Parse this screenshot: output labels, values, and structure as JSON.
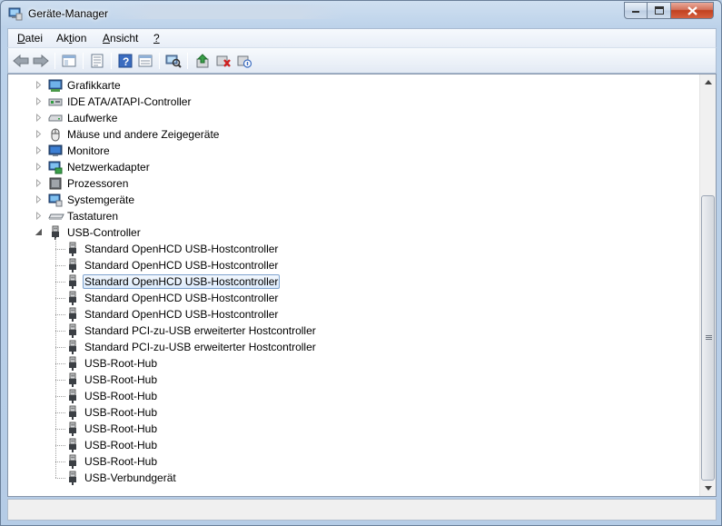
{
  "window": {
    "title": "Geräte-Manager"
  },
  "menu": [
    {
      "pre": "",
      "ul": "D",
      "post": "atei"
    },
    {
      "pre": "Ak",
      "ul": "t",
      "post": "ion"
    },
    {
      "pre": "",
      "ul": "A",
      "post": "nsicht"
    },
    {
      "pre": "",
      "ul": "?",
      "post": ""
    }
  ],
  "toolbar": [
    {
      "name": "back-button-icon"
    },
    {
      "name": "forward-button-icon"
    },
    {
      "name": "show-hide-tree-icon"
    },
    {
      "name": "properties-icon"
    },
    {
      "name": "help-icon"
    },
    {
      "name": "view-details-icon"
    },
    {
      "name": "scan-hardware-icon"
    },
    {
      "name": "update-driver-icon"
    },
    {
      "name": "uninstall-icon"
    },
    {
      "name": "disable-device-icon"
    }
  ],
  "tree": {
    "categories": [
      {
        "label": "Grafikkarte",
        "icon": "display-adapter-icon",
        "expanded": false
      },
      {
        "label": "IDE ATA/ATAPI-Controller",
        "icon": "ide-controller-icon",
        "expanded": false
      },
      {
        "label": "Laufwerke",
        "icon": "disk-drive-icon",
        "expanded": false
      },
      {
        "label": "Mäuse und andere Zeigegeräte",
        "icon": "mouse-icon",
        "expanded": false
      },
      {
        "label": "Monitore",
        "icon": "monitor-icon",
        "expanded": false
      },
      {
        "label": "Netzwerkadapter",
        "icon": "network-adapter-icon",
        "expanded": false
      },
      {
        "label": "Prozessoren",
        "icon": "processor-icon",
        "expanded": false
      },
      {
        "label": "Systemgeräte",
        "icon": "system-devices-icon",
        "expanded": false
      },
      {
        "label": "Tastaturen",
        "icon": "keyboard-icon",
        "expanded": false
      },
      {
        "label": "USB-Controller",
        "icon": "usb-plug-icon",
        "expanded": true
      }
    ],
    "usb_children": [
      {
        "label": "Standard OpenHCD USB-Hostcontroller",
        "selected": false
      },
      {
        "label": "Standard OpenHCD USB-Hostcontroller",
        "selected": false
      },
      {
        "label": "Standard OpenHCD USB-Hostcontroller",
        "selected": true
      },
      {
        "label": "Standard OpenHCD USB-Hostcontroller",
        "selected": false
      },
      {
        "label": "Standard OpenHCD USB-Hostcontroller",
        "selected": false
      },
      {
        "label": "Standard PCI-zu-USB erweiterter Hostcontroller",
        "selected": false
      },
      {
        "label": "Standard PCI-zu-USB erweiterter Hostcontroller",
        "selected": false
      },
      {
        "label": "USB-Root-Hub",
        "selected": false
      },
      {
        "label": "USB-Root-Hub",
        "selected": false
      },
      {
        "label": "USB-Root-Hub",
        "selected": false
      },
      {
        "label": "USB-Root-Hub",
        "selected": false
      },
      {
        "label": "USB-Root-Hub",
        "selected": false
      },
      {
        "label": "USB-Root-Hub",
        "selected": false
      },
      {
        "label": "USB-Root-Hub",
        "selected": false
      },
      {
        "label": "USB-Verbundgerät",
        "selected": false
      }
    ]
  }
}
